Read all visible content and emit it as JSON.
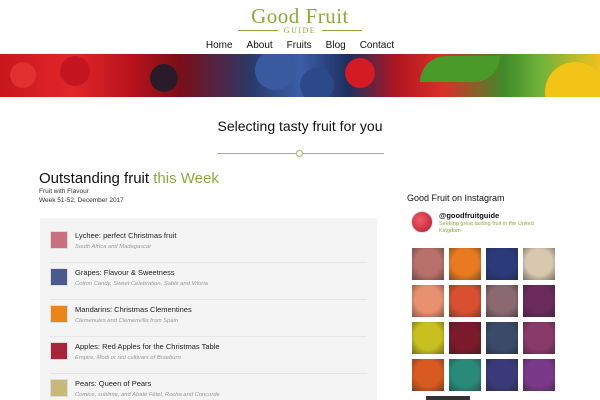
{
  "logo": {
    "main": "Good Fruit",
    "sub": "GUIDE"
  },
  "nav": [
    "Home",
    "About",
    "Fruits",
    "Blog",
    "Contact"
  ],
  "tagline": "Selecting tasty fruit for you",
  "section": {
    "title_plain": "Outstanding fruit ",
    "title_accent": "this Week",
    "sub1": "Fruit with Flavour",
    "sub2": "Week 51-52, December 2017"
  },
  "fruits": [
    {
      "title": "Lychee: perfect Christmas fruit",
      "desc": "South Africa and Madagascar",
      "thumb_color": "#c9707e"
    },
    {
      "title": "Grapes: Flavour & Sweetness",
      "desc": "Cotton Candy, Sweet Celebration, Sable and Vitoria",
      "thumb_color": "#4a5a8a"
    },
    {
      "title": "Mandarins: Christmas Clementines",
      "desc": "Clemenules and Clemenvilla from Spain",
      "thumb_color": "#e8861a"
    },
    {
      "title": "Apples: Red Apples for the Christmas Table",
      "desc": "Empire, Modi or red cultivars of Braeburn",
      "thumb_color": "#a8243a"
    },
    {
      "title": "Pears: Queen of Pears",
      "desc": "Comice, sublime, and Abaté Fétel, Rocha and Concorde",
      "thumb_color": "#c8b87a"
    }
  ],
  "instagram": {
    "title": "Good Fruit on Instagram",
    "handle": "@goodfruitguide",
    "bio": "Seeking great tasting fruit in the United Kingdom",
    "tiles": [
      "#b8706a",
      "#e87a20",
      "#2a3a7a",
      "#d8c8b0",
      "#e89070",
      "#d85030",
      "#8a6a70",
      "#6a2a5a",
      "#c8c020",
      "#7a1a2a",
      "#3a4a6a",
      "#8a3a6a",
      "#d85a20",
      "#2a8a7a",
      "#3a3a7a",
      "#7a3a8a"
    ]
  }
}
